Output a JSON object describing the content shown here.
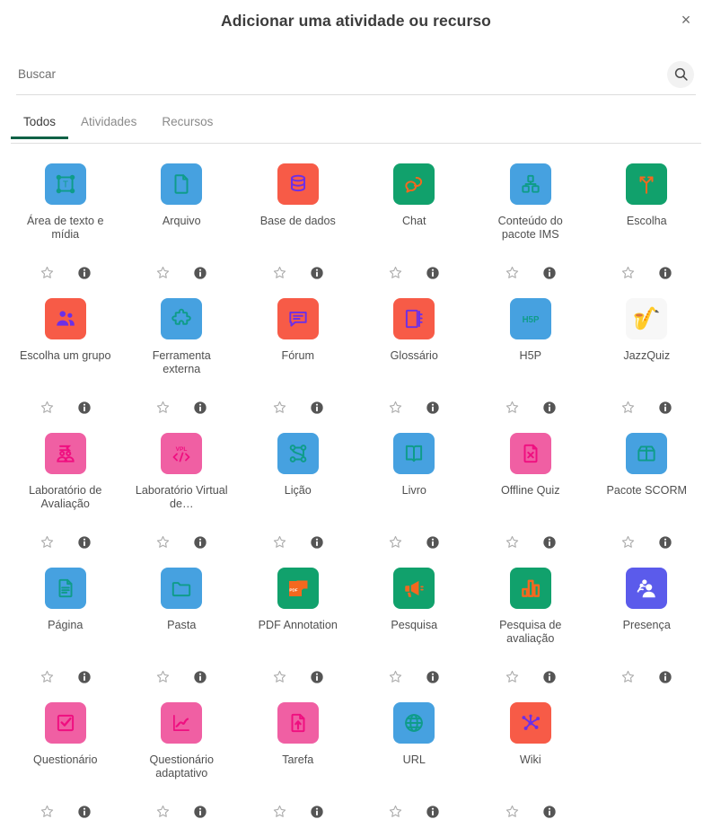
{
  "modal": {
    "title": "Adicionar uma atividade ou recurso",
    "close_label": "×",
    "close_icon": "close-icon"
  },
  "search": {
    "placeholder": "Buscar",
    "value": "",
    "icon": "search-icon"
  },
  "tabs": [
    {
      "label": "Todos",
      "active": true
    },
    {
      "label": "Atividades",
      "active": false
    },
    {
      "label": "Recursos",
      "active": false
    }
  ],
  "actions": {
    "star_icon": "star-outline-icon",
    "info_icon": "info-circle-icon"
  },
  "colors": {
    "tab_active_underline": "#106246",
    "tile_blue": "#46a1e0",
    "tile_green": "#11a16c",
    "tile_red": "#f75b47",
    "tile_pink": "#ef4b93",
    "tile_pink_light": "#f05fa3",
    "tile_indigo": "#5b5beb",
    "tile_white": "#f7f7f7",
    "glyph_teal": "#0f9c8a",
    "glyph_purple": "#6b2fe8",
    "glyph_orange": "#f4681f",
    "glyph_pink": "#ef0f80",
    "glyph_white": "#ffffff",
    "text": "#4f4f4f"
  },
  "items": [
    {
      "name": "Área de texto e mídia",
      "icon": "text-media-area-icon",
      "tile": "blue",
      "glyph": "teal"
    },
    {
      "name": "Arquivo",
      "icon": "file-icon",
      "tile": "blue",
      "glyph": "teal"
    },
    {
      "name": "Base de dados",
      "icon": "database-icon",
      "tile": "red",
      "glyph": "purple"
    },
    {
      "name": "Chat",
      "icon": "chat-bubbles-icon",
      "tile": "green",
      "glyph": "orange"
    },
    {
      "name": "Conteúdo do pacote IMS",
      "icon": "ims-package-icon",
      "tile": "blue",
      "glyph": "teal"
    },
    {
      "name": "Escolha",
      "icon": "choice-fork-icon",
      "tile": "green",
      "glyph": "orange"
    },
    {
      "name": "Escolha um grupo",
      "icon": "group-choice-icon",
      "tile": "red",
      "glyph": "purple"
    },
    {
      "name": "Ferramenta externa",
      "icon": "puzzle-piece-icon",
      "tile": "blue",
      "glyph": "teal"
    },
    {
      "name": "Fórum",
      "icon": "forum-icon",
      "tile": "red",
      "glyph": "purple"
    },
    {
      "name": "Glossário",
      "icon": "glossary-book-icon",
      "tile": "red",
      "glyph": "purple"
    },
    {
      "name": "H5P",
      "icon": "h5p-icon",
      "tile": "blue",
      "glyph": "teal"
    },
    {
      "name": "JazzQuiz",
      "icon": "saxophone-icon",
      "tile": "white",
      "glyph": "emoji"
    },
    {
      "name": "Laboratório de Avaliação",
      "icon": "workshop-icon",
      "tile": "pink",
      "glyph": "pink-dark"
    },
    {
      "name": "Laboratório Virtual de…",
      "icon": "vpl-code-icon",
      "tile": "pink",
      "glyph": "pink-dark"
    },
    {
      "name": "Lição",
      "icon": "lesson-flow-icon",
      "tile": "blue",
      "glyph": "teal"
    },
    {
      "name": "Livro",
      "icon": "book-open-icon",
      "tile": "blue",
      "glyph": "teal"
    },
    {
      "name": "Offline Quiz",
      "icon": "offline-quiz-icon",
      "tile": "pink",
      "glyph": "pink-dark"
    },
    {
      "name": "Pacote SCORM",
      "icon": "scorm-package-icon",
      "tile": "blue",
      "glyph": "teal"
    },
    {
      "name": "Página",
      "icon": "page-icon",
      "tile": "blue",
      "glyph": "teal"
    },
    {
      "name": "Pasta",
      "icon": "folder-icon",
      "tile": "blue",
      "glyph": "teal"
    },
    {
      "name": "PDF Annotation",
      "icon": "pdf-annotation-icon",
      "tile": "green",
      "glyph": "orange"
    },
    {
      "name": "Pesquisa",
      "icon": "megaphone-icon",
      "tile": "green",
      "glyph": "orange"
    },
    {
      "name": "Pesquisa de avaliação",
      "icon": "bar-chart-icon",
      "tile": "green",
      "glyph": "orange"
    },
    {
      "name": "Presença",
      "icon": "attendance-people-icon",
      "tile": "indigo",
      "glyph": "white"
    },
    {
      "name": "Questionário",
      "icon": "quiz-checkbox-icon",
      "tile": "pink",
      "glyph": "pink-dark"
    },
    {
      "name": "Questionário adaptativo",
      "icon": "adaptive-quiz-chart-icon",
      "tile": "pink",
      "glyph": "pink-dark"
    },
    {
      "name": "Tarefa",
      "icon": "assignment-upload-icon",
      "tile": "pink",
      "glyph": "pink-dark"
    },
    {
      "name": "URL",
      "icon": "globe-icon",
      "tile": "blue",
      "glyph": "teal"
    },
    {
      "name": "Wiki",
      "icon": "wiki-network-icon",
      "tile": "red",
      "glyph": "purple"
    }
  ]
}
